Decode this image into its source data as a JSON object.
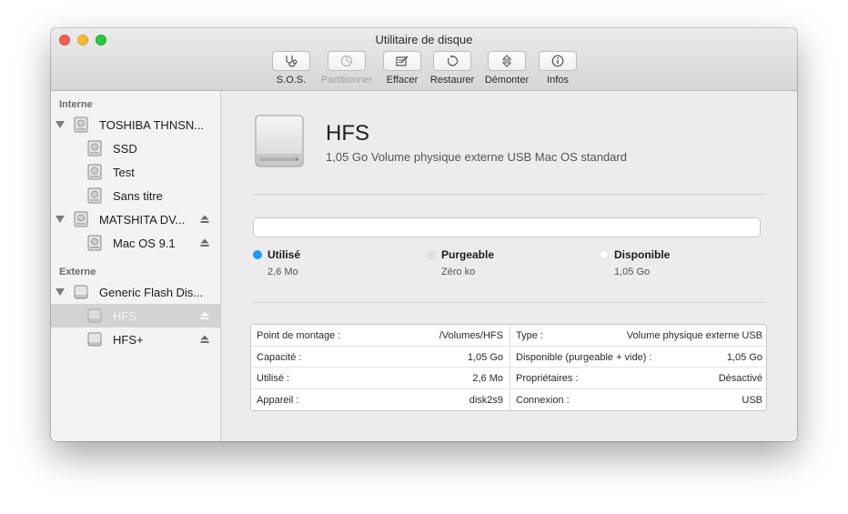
{
  "window": {
    "title": "Utilitaire de disque"
  },
  "toolbar": {
    "first_aid": "S.O.S.",
    "partition": "Partitionner",
    "erase": "Effacer",
    "restore": "Restaurer",
    "unmount": "Démonter",
    "info": "Infos"
  },
  "sidebar": {
    "internal_header": "Interne",
    "external_header": "Externe",
    "items": [
      {
        "label": "TOSHIBA THNSN..."
      },
      {
        "label": "SSD"
      },
      {
        "label": "Test"
      },
      {
        "label": "Sans titre"
      },
      {
        "label": "MATSHITA DV..."
      },
      {
        "label": "Mac OS 9.1"
      },
      {
        "label": "Generic Flash Dis..."
      },
      {
        "label": "HFS"
      },
      {
        "label": "HFS+"
      }
    ]
  },
  "volume": {
    "name": "HFS",
    "description": "1,05 Go Volume physique externe USB Mac OS standard"
  },
  "usage": {
    "used": {
      "label": "Utilisé",
      "value": "2,6 Mo",
      "color": "#1a9cf5"
    },
    "purgeable": {
      "label": "Purgeable",
      "value": "Zéro ko"
    },
    "available": {
      "label": "Disponible",
      "value": "1,05 Go",
      "color": "#ffffff"
    }
  },
  "info": {
    "left": [
      {
        "key": "Point de montage :",
        "value": "/Volumes/HFS"
      },
      {
        "key": "Capacité :",
        "value": "1,05 Go"
      },
      {
        "key": "Utilisé :",
        "value": "2,6 Mo"
      },
      {
        "key": "Appareil :",
        "value": "disk2s9"
      }
    ],
    "right": [
      {
        "key": "Type :",
        "value": "Volume physique externe USB"
      },
      {
        "key": "Disponible (purgeable + vide) :",
        "value": "1,05 Go"
      },
      {
        "key": "Propriétaires :",
        "value": "Désactivé"
      },
      {
        "key": "Connexion :",
        "value": "USB"
      }
    ]
  }
}
